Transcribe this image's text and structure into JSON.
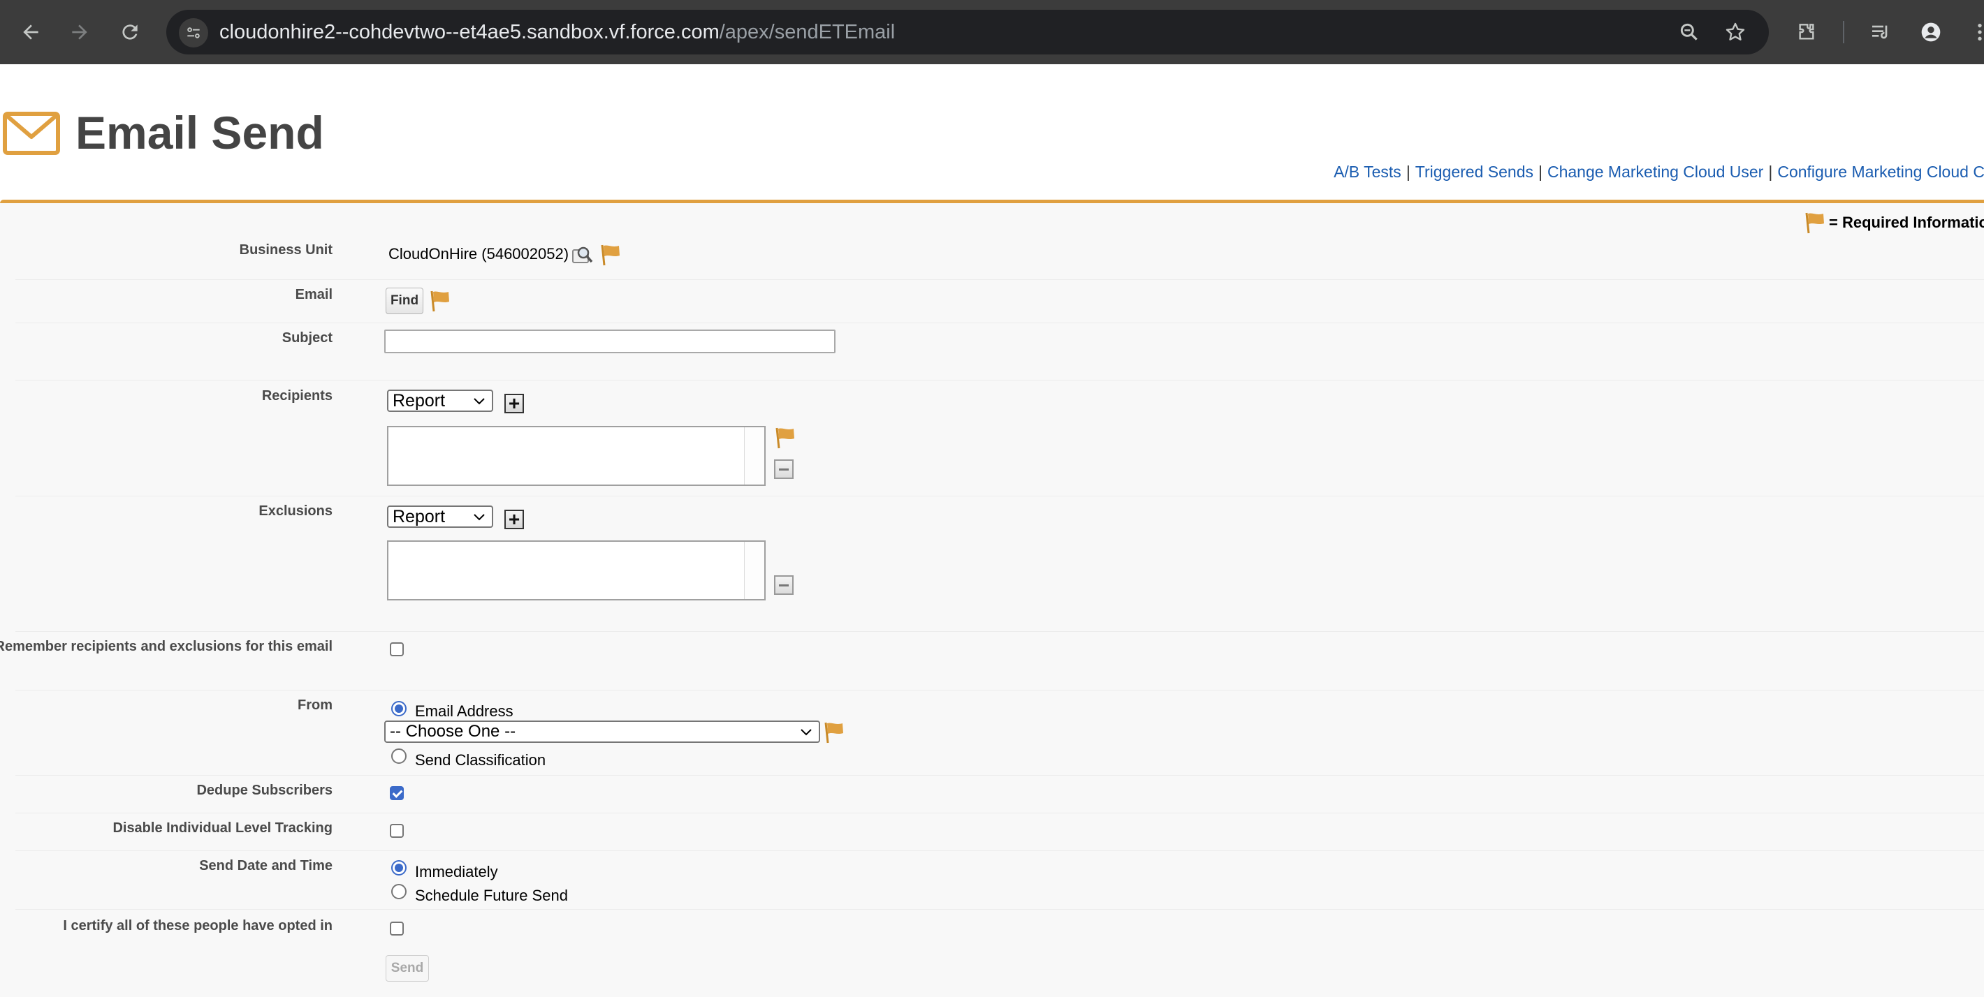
{
  "browser": {
    "url_host": "cloudonhire2--cohdevtwo--et4ae5.sandbox.vf.force.com",
    "url_path": "/apex/sendETEmail"
  },
  "page": {
    "title": "Email Send",
    "accent_color": "#e0a040",
    "links": [
      "A/B Tests",
      "Triggered Sends",
      "Change Marketing Cloud User",
      "Configure Marketing Cloud Connect"
    ],
    "link_separator": "|",
    "required_legend": "= Required Information"
  },
  "form": {
    "business_unit": {
      "label": "Business Unit",
      "value": "CloudOnHire (546002052)"
    },
    "email": {
      "label": "Email",
      "button": "Find"
    },
    "subject": {
      "label": "Subject",
      "value": ""
    },
    "recipients": {
      "label": "Recipients",
      "select_value": "Report"
    },
    "exclusions": {
      "label": "Exclusions",
      "select_value": "Report"
    },
    "remember": {
      "label": "Remember recipients and exclusions for this email",
      "checked": false
    },
    "from": {
      "label": "From",
      "option_email": "Email Address",
      "choose_placeholder": "-- Choose One --",
      "option_classification": "Send Classification",
      "selected": "Email Address"
    },
    "dedupe": {
      "label": "Dedupe Subscribers",
      "checked": true
    },
    "disable_tracking": {
      "label": "Disable Individual Level Tracking",
      "checked": false
    },
    "send_date": {
      "label": "Send Date and Time",
      "option_immediately": "Immediately",
      "option_schedule": "Schedule Future Send",
      "selected": "Immediately"
    },
    "certify": {
      "label": "I certify all of these people have opted in",
      "checked": false
    },
    "send_button": "Send"
  }
}
